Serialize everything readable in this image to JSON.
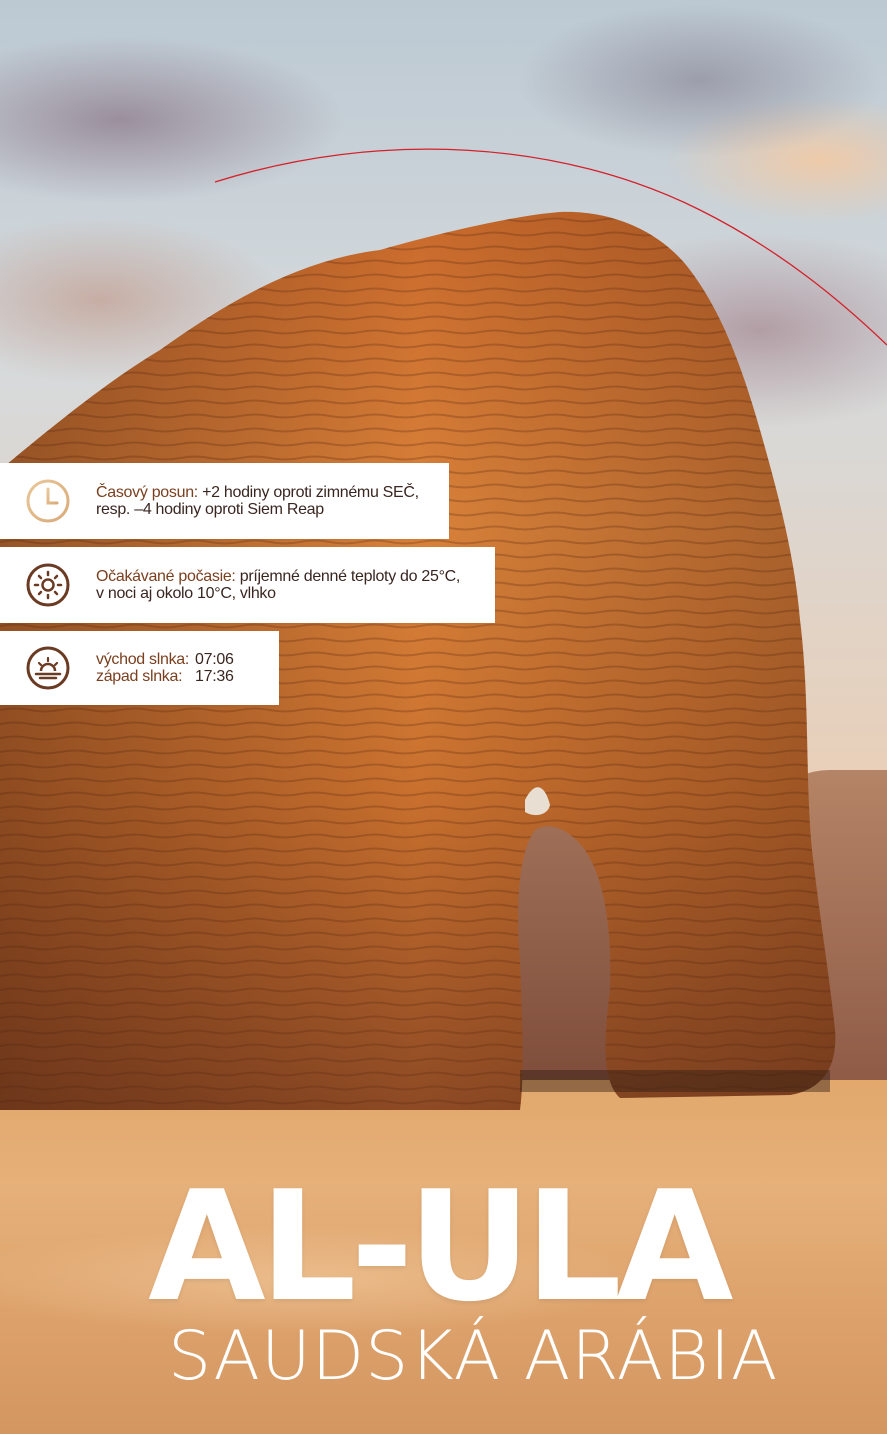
{
  "info": {
    "time_offset": {
      "icon": "clock-icon",
      "label": "Časový posun:",
      "text_line1": " +2 hodiny oproti zimnému SEČ,",
      "text_line2": "resp. –4 hodiny oproti Siem Reap"
    },
    "weather": {
      "icon": "sun-icon",
      "label": "Očakávané počasie:",
      "text_line1": " príjemné denné teploty do 25°C,",
      "text_line2": "v noci aj okolo 10°C, vlhko"
    },
    "sun": {
      "icon": "sunrise-icon",
      "sunrise_label": "východ slnka:",
      "sunrise_time": "07:06",
      "sunset_label": "západ slnka:",
      "sunset_time": "17:36"
    }
  },
  "title": "AL-ULA",
  "subtitle": "SAUDSKÁ ARÁBIA",
  "colors": {
    "accent_red": "#d4202a",
    "icon_brown": "#6b3a22",
    "label_brown": "#7a3f1f"
  }
}
